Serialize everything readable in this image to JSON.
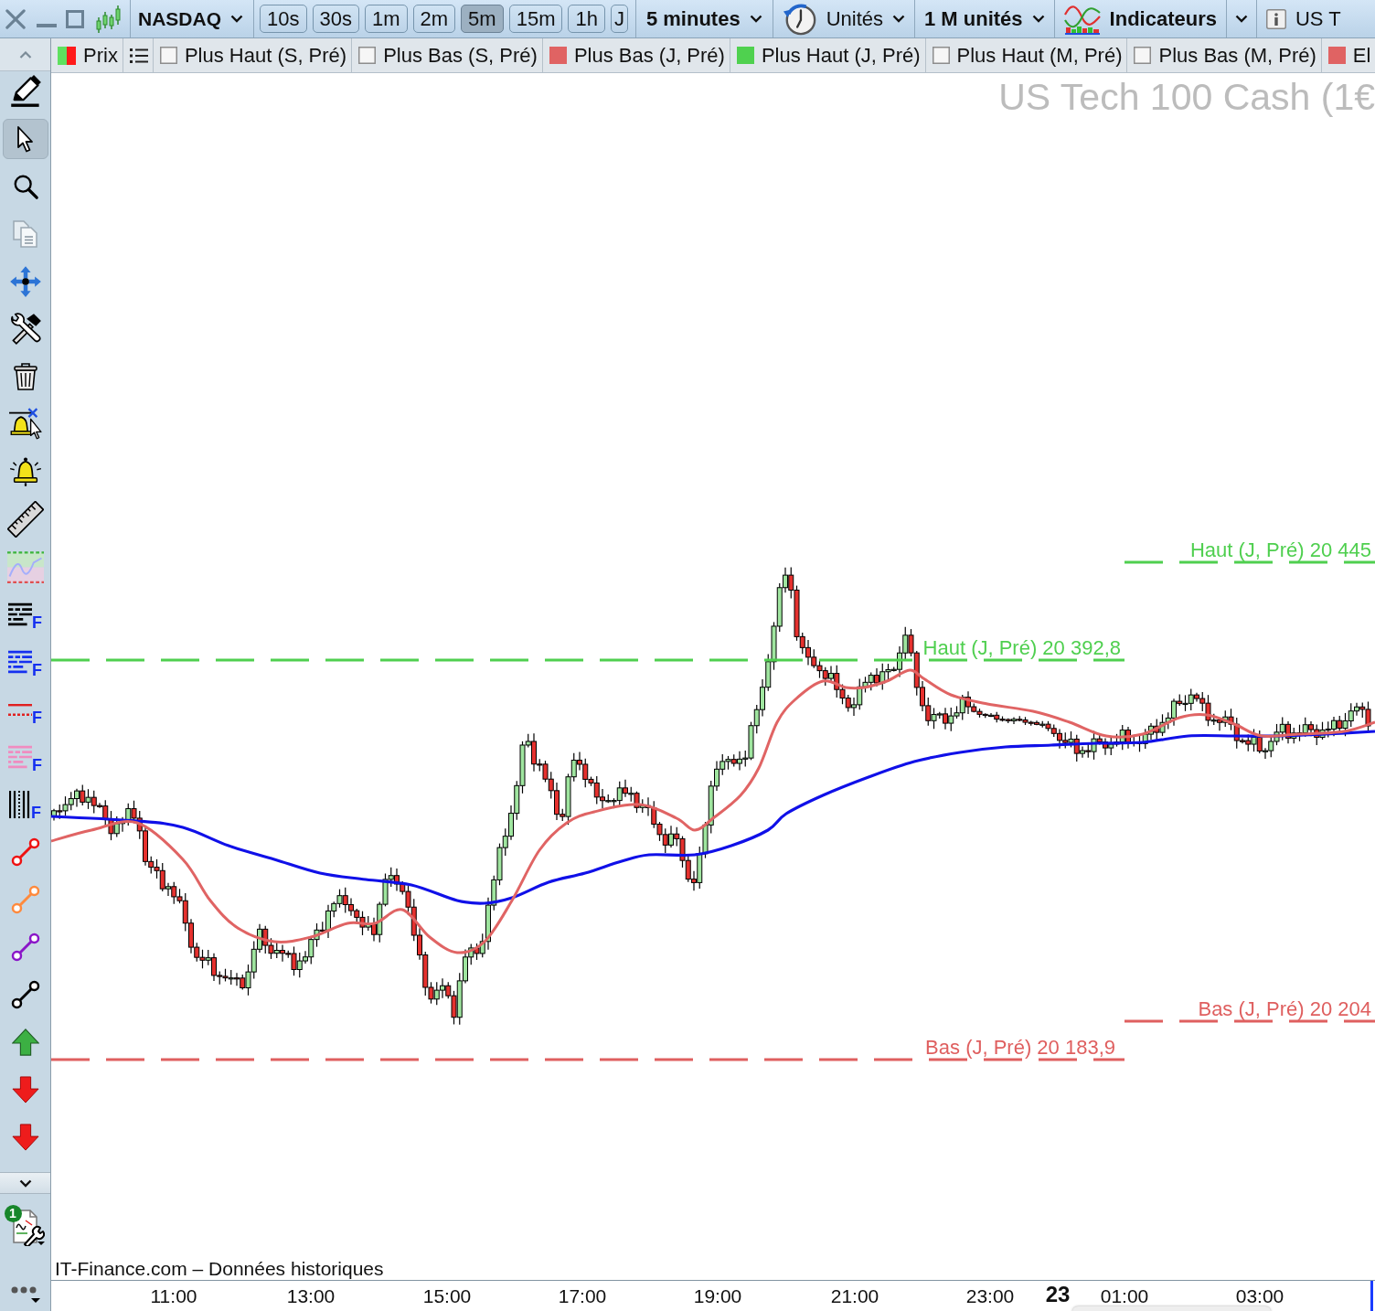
{
  "toolbar": {
    "symbol": "NASDAQ",
    "timeframes": [
      {
        "label": "10s",
        "selected": false
      },
      {
        "label": "30s",
        "selected": false
      },
      {
        "label": "1m",
        "selected": false
      },
      {
        "label": "2m",
        "selected": false
      },
      {
        "label": "5m",
        "selected": true
      },
      {
        "label": "15m",
        "selected": false
      },
      {
        "label": "1h",
        "selected": false
      },
      {
        "label": "J",
        "selected": false
      }
    ],
    "period": "5 minutes",
    "units": "Unités",
    "unit_count": "1 M unités",
    "indicators": "Indicateurs",
    "instrument": "US T"
  },
  "legend": {
    "price": "Prix",
    "series": [
      {
        "label": "Plus Haut (S, Pré)",
        "checked": false
      },
      {
        "label": "Plus Bas (S, Pré)",
        "checked": false
      },
      {
        "label": "Plus Bas (J, Pré)",
        "checked": true,
        "color": "#e06363"
      },
      {
        "label": "Plus Haut (J, Pré)",
        "checked": true,
        "color": "#4fd14f"
      },
      {
        "label": "Plus Haut (M, Pré)",
        "checked": false
      },
      {
        "label": "Plus Bas (M, Pré)",
        "checked": false
      },
      {
        "label": "El",
        "checked": true,
        "color": "#e06363"
      }
    ]
  },
  "left_toolbar": {
    "tools": [
      {
        "selected": false
      },
      {
        "selected": true
      },
      {
        "selected": false
      },
      {
        "selected": false
      },
      {
        "selected": false
      },
      {
        "selected": false
      },
      {
        "selected": false
      },
      {
        "selected": false
      },
      {
        "selected": false
      },
      {
        "selected": false
      },
      {
        "selected": false
      },
      {
        "selected": false,
        "badge": "F"
      },
      {
        "selected": false,
        "badge": "F"
      },
      {
        "selected": false,
        "badge": "F"
      },
      {
        "selected": false,
        "badge": "F"
      },
      {
        "selected": false,
        "badge": "F"
      },
      {
        "selected": false
      },
      {
        "selected": false
      },
      {
        "selected": false
      },
      {
        "selected": false
      },
      {
        "selected": false
      },
      {
        "selected": false
      },
      {
        "selected": false
      }
    ],
    "notifications": "1"
  },
  "chart": {
    "title": "US Tech 100 Cash (1€",
    "levels": [
      {
        "label": "Haut (J, Pré) 20 445",
        "kind": "high"
      },
      {
        "label": "Haut (J, Pré) 20 392,8",
        "kind": "high"
      },
      {
        "label": "Bas (J, Pré) 20 204",
        "kind": "low"
      },
      {
        "label": "Bas (J, Pré) 20 183,9",
        "kind": "low"
      }
    ],
    "source": "IT-Finance.com – Données historiques",
    "time_axis": [
      {
        "label": "11:00",
        "kind": "time"
      },
      {
        "label": "13:00",
        "kind": "time"
      },
      {
        "label": "15:00",
        "kind": "time"
      },
      {
        "label": "17:00",
        "kind": "time"
      },
      {
        "label": "19:00",
        "kind": "time"
      },
      {
        "label": "21:00",
        "kind": "time"
      },
      {
        "label": "23:00",
        "kind": "time"
      },
      {
        "label": "23",
        "kind": "date"
      },
      {
        "label": "01:00",
        "kind": "time"
      },
      {
        "label": "03:00",
        "kind": "time"
      }
    ]
  }
}
